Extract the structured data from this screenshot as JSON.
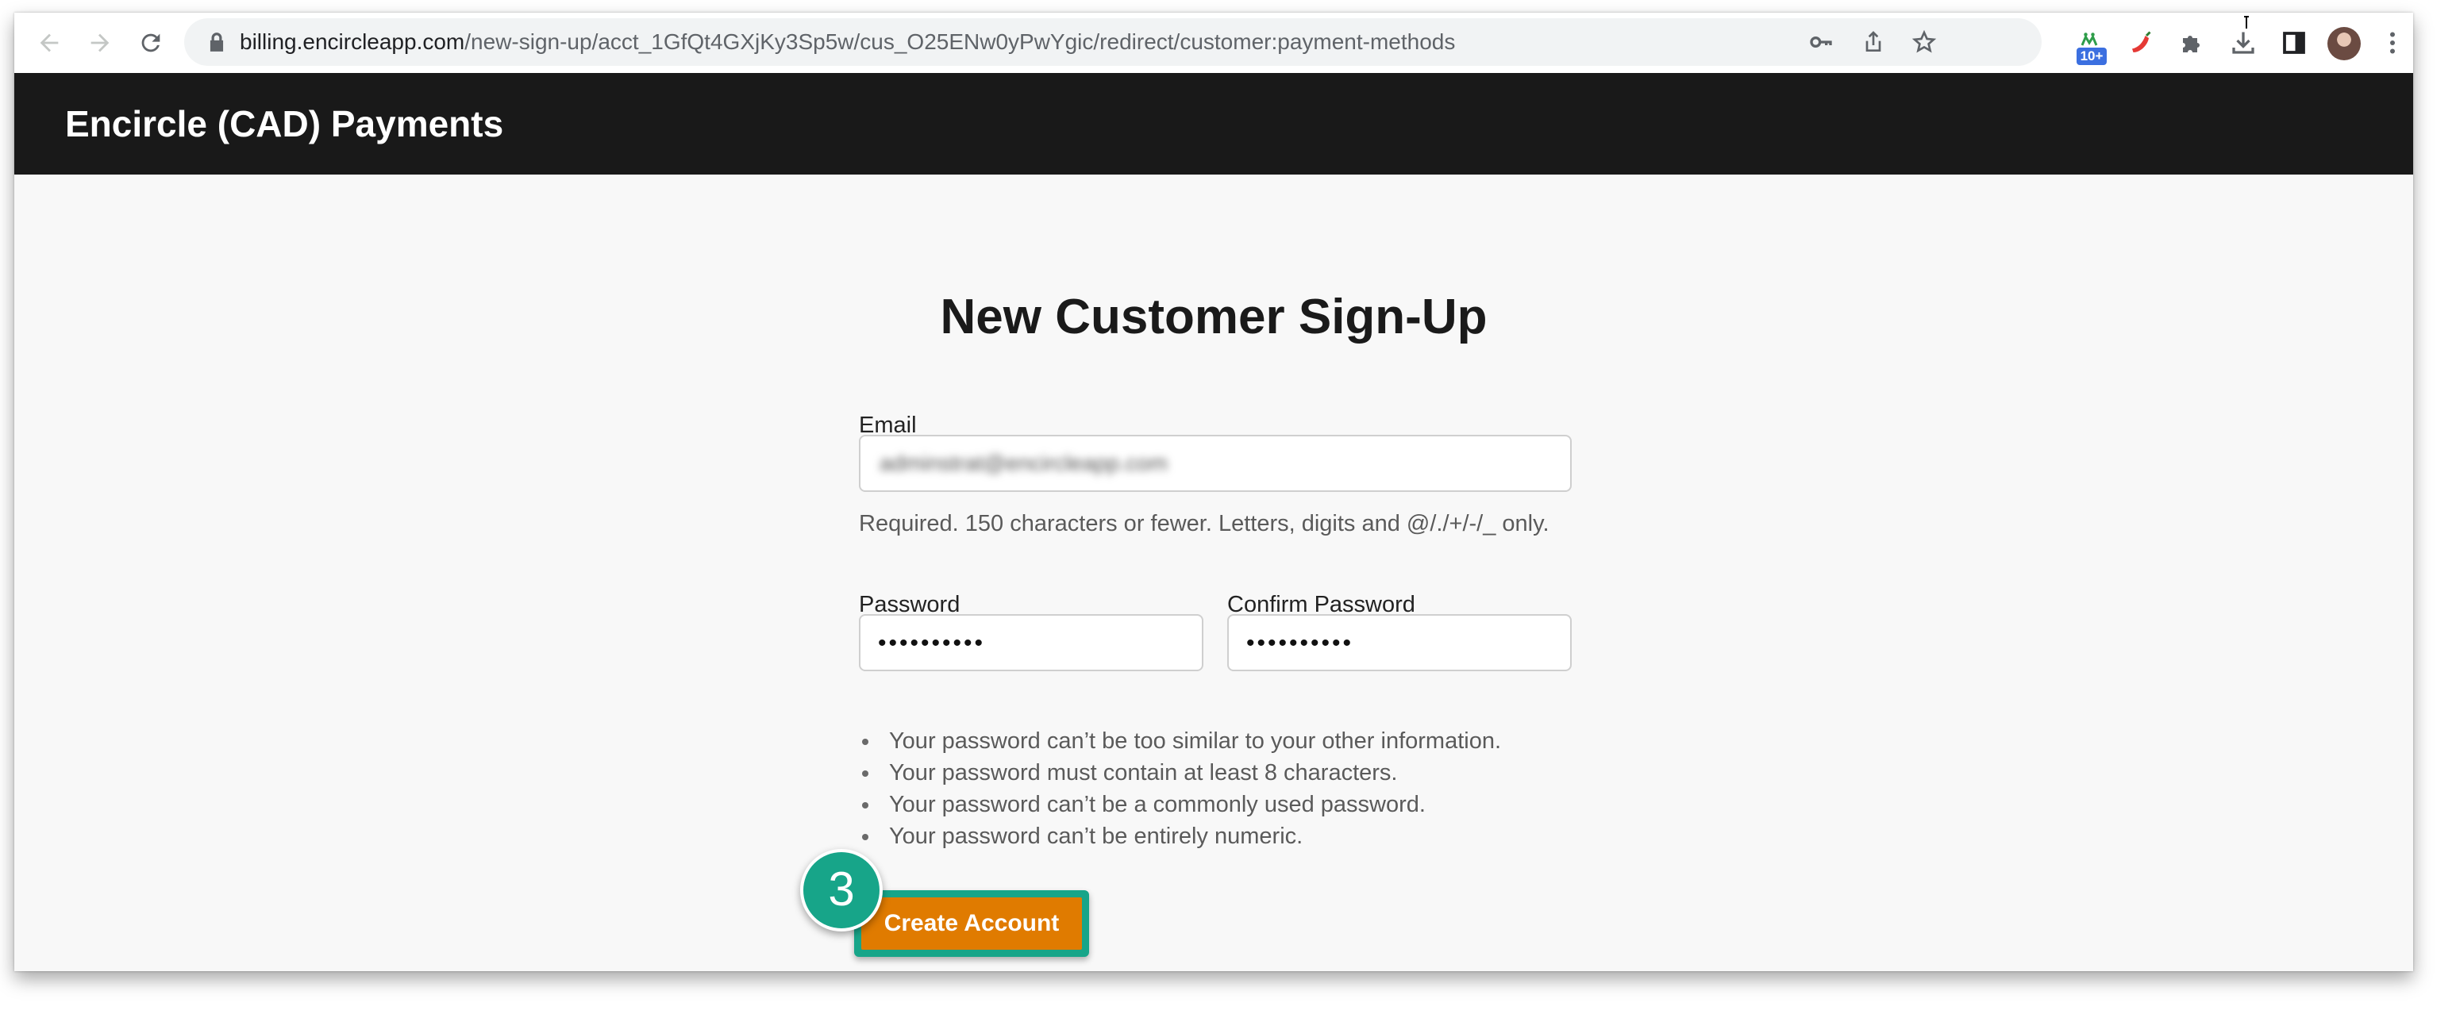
{
  "browser": {
    "url_host": "billing.encircleapp.com",
    "url_path": "/new-sign-up/acct_1GfQt4GXjKy3Sp5w/cus_O25ENw0yPwYgic/redirect/customer:payment-methods",
    "extension_badge": "10+",
    "icons": [
      "back-icon",
      "forward-icon",
      "reload-icon",
      "lock-icon",
      "key-icon",
      "share-icon",
      "star-icon",
      "extension-icon",
      "pepper-icon",
      "puzzle-icon",
      "download-icon",
      "side-panel-icon",
      "avatar",
      "menu-icon"
    ]
  },
  "header": {
    "title": "Encircle (CAD) Payments"
  },
  "form": {
    "title": "New Customer Sign-Up",
    "email_label": "Email",
    "email_value": "adminstrat@encircleapp.com",
    "email_help": "Required. 150 characters or fewer. Letters, digits and @/./+/-/_ only.",
    "password_label": "Password",
    "password_value": "••••••••••",
    "confirm_label": "Confirm Password",
    "confirm_value": "••••••••••",
    "rules": [
      "Your password can’t be too similar to your other information.",
      "Your password must contain at least 8 characters.",
      "Your password can’t be a commonly used password.",
      "Your password can’t be entirely numeric."
    ],
    "submit_label": "Create Account"
  },
  "annotation": {
    "step_number": "3",
    "color": "#17a589"
  },
  "colors": {
    "header_bg": "#191919",
    "button_bg": "#e07b00",
    "accent": "#17a589"
  }
}
